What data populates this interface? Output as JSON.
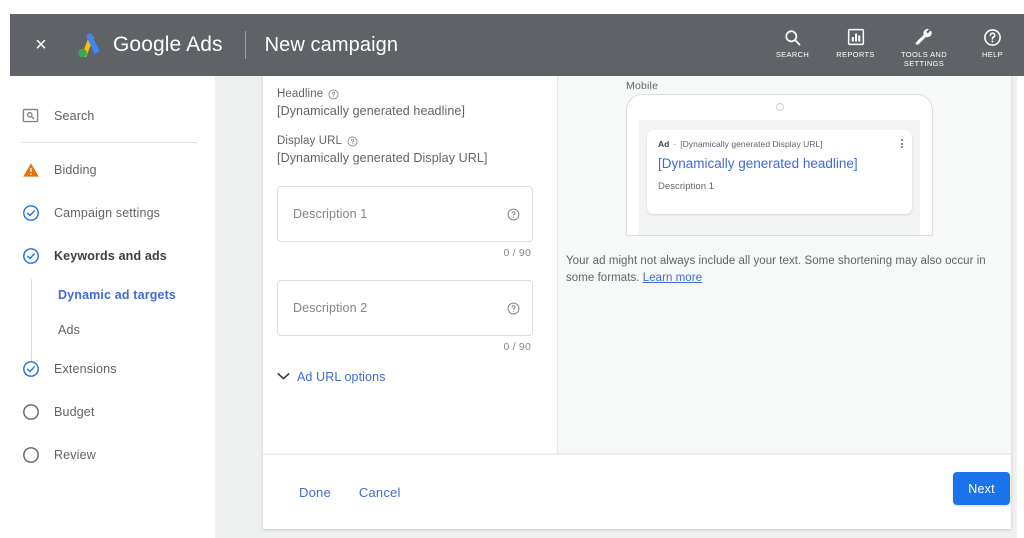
{
  "header": {
    "close_label": "×",
    "brand": "Google Ads",
    "page_title": "New campaign",
    "actions": [
      {
        "label": "SEARCH",
        "icon": "search-icon"
      },
      {
        "label": "REPORTS",
        "icon": "reports-icon"
      },
      {
        "label": "TOOLS AND SETTINGS",
        "icon": "tools-icon"
      },
      {
        "label": "HELP",
        "icon": "help-icon"
      }
    ]
  },
  "sidebar": {
    "items": [
      {
        "label": "Search",
        "icon": "search-box-icon",
        "state": "search"
      },
      {
        "label": "Bidding",
        "icon": "warning-triangle-icon",
        "state": "warning"
      },
      {
        "label": "Campaign settings",
        "icon": "check-circle-icon",
        "state": "complete"
      },
      {
        "label": "Keywords and ads",
        "icon": "check-circle-icon",
        "state": "complete-active"
      },
      {
        "label": "Extensions",
        "icon": "check-circle-icon",
        "state": "complete"
      },
      {
        "label": "Budget",
        "icon": "empty-circle-icon",
        "state": "pending"
      },
      {
        "label": "Review",
        "icon": "empty-circle-icon",
        "state": "pending"
      }
    ],
    "subitems": [
      {
        "label": "Dynamic ad targets",
        "active": true
      },
      {
        "label": "Ads",
        "active": false
      }
    ]
  },
  "form": {
    "headline_label": "Headline",
    "headline_value": "[Dynamically generated headline]",
    "display_url_label": "Display URL",
    "display_url_value": "[Dynamically generated Display URL]",
    "description1_placeholder": "Description 1",
    "description1_counter": "0 / 90",
    "description2_placeholder": "Description 2",
    "description2_counter": "0 / 90",
    "ad_url_options_label": "Ad URL options"
  },
  "preview": {
    "device_label": "Mobile",
    "ad_badge": "Ad",
    "separator": "·",
    "display_url": "[Dynamically generated Display URL]",
    "headline": "[Dynamically generated headline]",
    "description": "Description 1",
    "disclaimer_text": "Your ad might not always include all your text. Some shortening may also occur in some formats.",
    "learn_more_label": "Learn more"
  },
  "footer": {
    "done_label": "Done",
    "cancel_label": "Cancel",
    "next_label": "Next"
  },
  "colors": {
    "accent_blue": "#1a73e8",
    "link_blue": "#3f6ad8",
    "header_gray": "#5f6368",
    "warning_orange": "#e8710a",
    "content_bg": "#eff1f1"
  }
}
